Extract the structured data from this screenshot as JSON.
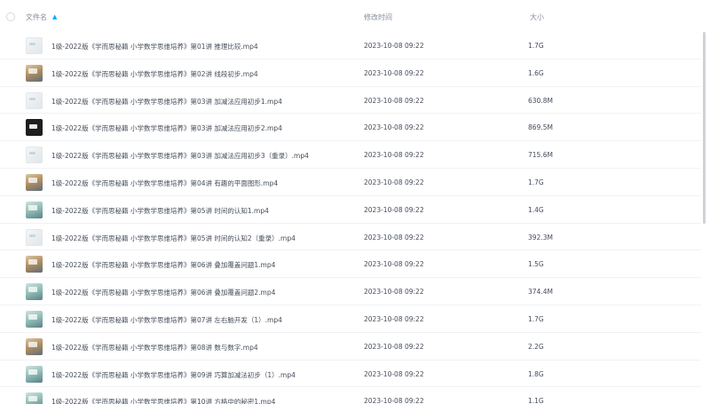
{
  "header": {
    "name_label": "文件名",
    "sort_icon": "arrow-up-icon",
    "time_label": "修改时间",
    "size_label": "大小"
  },
  "files": [
    {
      "name": "1级-2022版《学而思秘籍 小学数学思维培养》第01讲 推理比较.mp4",
      "time": "2023-10-08 09:22",
      "size": "1.7G",
      "thumb": "t-light"
    },
    {
      "name": "1级-2022版《学而思秘籍 小学数学思维培养》第02讲 线段初步.mp4",
      "time": "2023-10-08 09:22",
      "size": "1.6G",
      "thumb": "t-photo"
    },
    {
      "name": "1级-2022版《学而思秘籍 小学数学思维培养》第03讲 加减法应用初步1.mp4",
      "time": "2023-10-08 09:22",
      "size": "630.8M",
      "thumb": "t-light"
    },
    {
      "name": "1级-2022版《学而思秘籍 小学数学思维培养》第03讲 加减法应用初步2.mp4",
      "time": "2023-10-08 09:22",
      "size": "869.5M",
      "thumb": "t-dark"
    },
    {
      "name": "1级-2022版《学而思秘籍 小学数学思维培养》第03讲 加减法应用初步3（重录）.mp4",
      "time": "2023-10-08 09:22",
      "size": "715.6M",
      "thumb": "t-light"
    },
    {
      "name": "1级-2022版《学而思秘籍 小学数学思维培养》第04讲 有趣的平面图形.mp4",
      "time": "2023-10-08 09:22",
      "size": "1.7G",
      "thumb": "t-photo"
    },
    {
      "name": "1级-2022版《学而思秘籍 小学数学思维培养》第05讲 时间的认知1.mp4",
      "time": "2023-10-08 09:22",
      "size": "1.4G",
      "thumb": "t-teal"
    },
    {
      "name": "1级-2022版《学而思秘籍 小学数学思维培养》第05讲 时间的认知2（重录）.mp4",
      "time": "2023-10-08 09:22",
      "size": "392.3M",
      "thumb": "t-light"
    },
    {
      "name": "1级-2022版《学而思秘籍 小学数学思维培养》第06讲 叠加覆盖问题1.mp4",
      "time": "2023-10-08 09:22",
      "size": "1.5G",
      "thumb": "t-photo"
    },
    {
      "name": "1级-2022版《学而思秘籍 小学数学思维培养》第06讲 叠加覆盖问题2.mp4",
      "time": "2023-10-08 09:22",
      "size": "374.4M",
      "thumb": "t-teal"
    },
    {
      "name": "1级-2022版《学而思秘籍 小学数学思维培养》第07讲 左右脑开发（1）.mp4",
      "time": "2023-10-08 09:22",
      "size": "1.7G",
      "thumb": "t-teal"
    },
    {
      "name": "1级-2022版《学而思秘籍 小学数学思维培养》第08讲 数与数字.mp4",
      "time": "2023-10-08 09:22",
      "size": "2.2G",
      "thumb": "t-photo"
    },
    {
      "name": "1级-2022版《学而思秘籍 小学数学思维培养》第09讲 巧算加减法初步（1）.mp4",
      "time": "2023-10-08 09:22",
      "size": "1.8G",
      "thumb": "t-teal"
    },
    {
      "name": "1级-2022版《学而思秘籍 小学数学思维培养》第10讲 方格中的秘密1.mp4",
      "time": "2023-10-08 09:22",
      "size": "1.1G",
      "thumb": "t-teal"
    }
  ]
}
